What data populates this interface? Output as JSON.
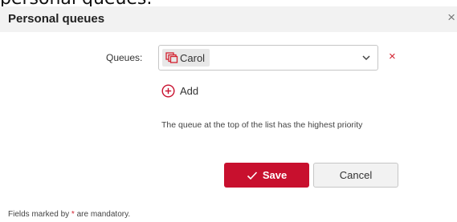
{
  "background_heading": "personal queues.",
  "dialog": {
    "title": "Personal queues",
    "close_label": "×"
  },
  "form": {
    "queues_label": "Queues:",
    "selected_queue": "Carol",
    "remove_label": "×",
    "add_label": "Add",
    "hint": "The queue at the top of the list has the highest priority"
  },
  "buttons": {
    "save_label": "Save",
    "cancel_label": "Cancel"
  },
  "footer": {
    "note_prefix": "Fields marked by ",
    "asterisk": "*",
    "note_suffix": " are mandatory."
  },
  "colors": {
    "accent": "#c8102e",
    "remove": "#d3212f",
    "title_bar": "#f2f2f2"
  },
  "icons": {
    "queue_chip": "queue-stack-icon",
    "dropdown": "chevron-down-icon",
    "add": "plus-circle-icon",
    "save": "checkmark-icon",
    "close": "close-icon"
  }
}
